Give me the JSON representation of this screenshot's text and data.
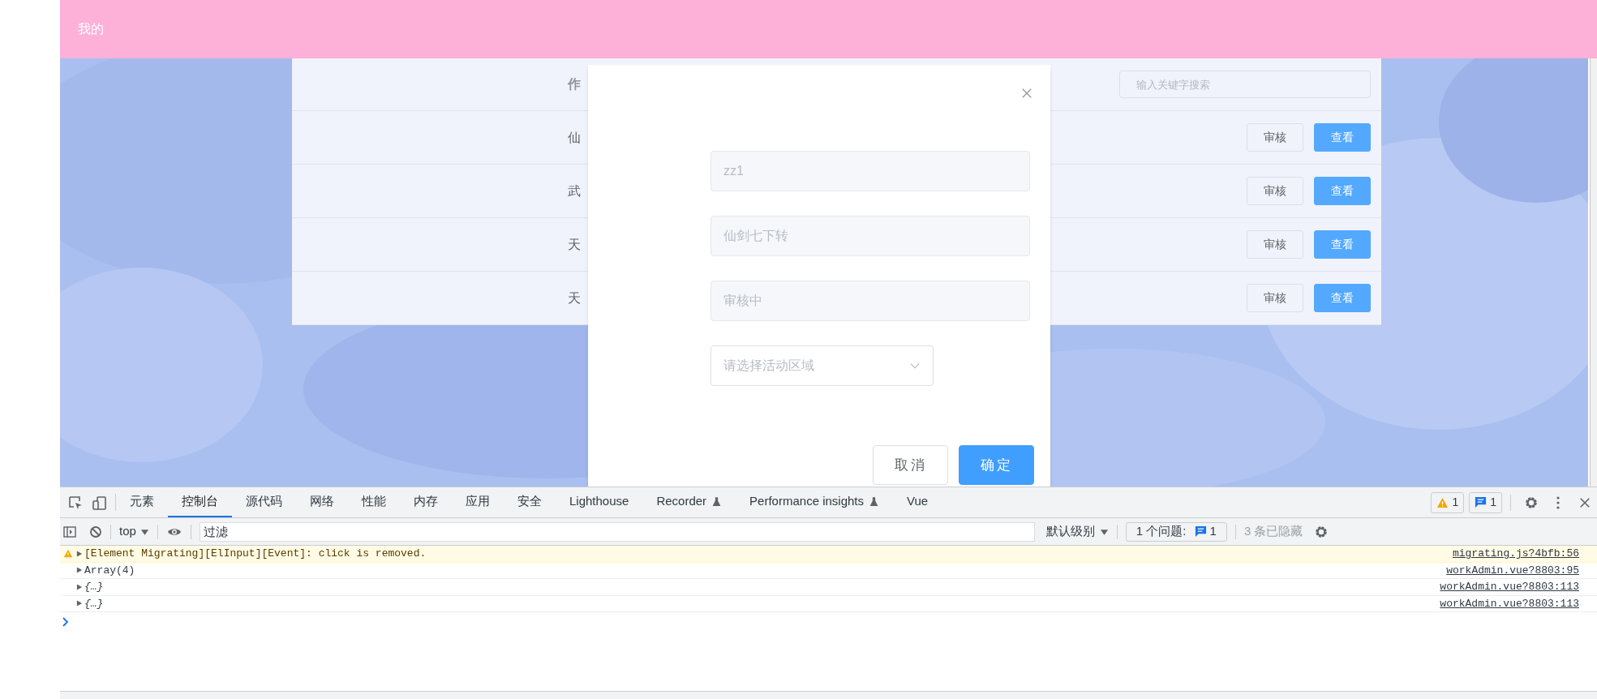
{
  "header": {
    "nav_text": "我的"
  },
  "table": {
    "header_text": "作",
    "search": {
      "placeholder": "输入关键字搜索"
    },
    "rows": [
      {
        "cell": "仙",
        "buttons": [
          {
            "label": "审核",
            "kind": "default"
          },
          {
            "label": "查看",
            "kind": "primary"
          }
        ]
      },
      {
        "cell": "武",
        "buttons": [
          {
            "label": "审核",
            "kind": "default"
          },
          {
            "label": "查看",
            "kind": "primary"
          }
        ]
      },
      {
        "cell": "天",
        "buttons": [
          {
            "label": "审核",
            "kind": "default"
          },
          {
            "label": "查看",
            "kind": "primary"
          }
        ]
      },
      {
        "cell": "天",
        "buttons": [
          {
            "label": "审核",
            "kind": "default"
          },
          {
            "label": "查看",
            "kind": "primary"
          }
        ]
      }
    ]
  },
  "dialog": {
    "fields": [
      {
        "kind": "input",
        "value": "zz1",
        "disabled": true
      },
      {
        "kind": "input",
        "value": "仙剑七下转",
        "disabled": true
      },
      {
        "kind": "input",
        "value": "审核中",
        "disabled": true
      },
      {
        "kind": "select",
        "placeholder": "请选择活动区域"
      }
    ],
    "buttons": [
      {
        "label": "取消",
        "kind": "default"
      },
      {
        "label": "确定",
        "kind": "primary"
      }
    ]
  },
  "devtools": {
    "tabs": [
      {
        "label": "元素",
        "selected": false,
        "experimental": false
      },
      {
        "label": "控制台",
        "selected": true,
        "experimental": false
      },
      {
        "label": "源代码",
        "selected": false,
        "experimental": false
      },
      {
        "label": "网络",
        "selected": false,
        "experimental": false
      },
      {
        "label": "性能",
        "selected": false,
        "experimental": false
      },
      {
        "label": "内存",
        "selected": false,
        "experimental": false
      },
      {
        "label": "应用",
        "selected": false,
        "experimental": false
      },
      {
        "label": "安全",
        "selected": false,
        "experimental": false
      },
      {
        "label": "Lighthouse",
        "selected": false,
        "experimental": false
      },
      {
        "label": "Recorder",
        "selected": false,
        "experimental": true
      },
      {
        "label": "Performance insights",
        "selected": false,
        "experimental": true
      },
      {
        "label": "Vue",
        "selected": false,
        "experimental": false
      }
    ],
    "badges": [
      {
        "kind": "warning",
        "count": "1"
      },
      {
        "kind": "info",
        "count": "1"
      }
    ],
    "context": "top",
    "filter": {
      "placeholder": "过滤"
    },
    "level": "默认级别",
    "issues": {
      "label": "1 个问题:",
      "count": "1"
    },
    "hidden": "3 条已隐藏",
    "messages": [
      {
        "kind": "warning",
        "text": "[Element Migrating][ElInput][Event]: click is removed.",
        "source": "migrating.js?4bfb:56"
      },
      {
        "kind": "log",
        "text": "Array(4)",
        "source": "workAdmin.vue?8803:95"
      },
      {
        "kind": "object",
        "text": "{…}",
        "source": "workAdmin.vue?8803:113"
      },
      {
        "kind": "object",
        "text": "{…}",
        "source": "workAdmin.vue?8803:113"
      }
    ]
  }
}
